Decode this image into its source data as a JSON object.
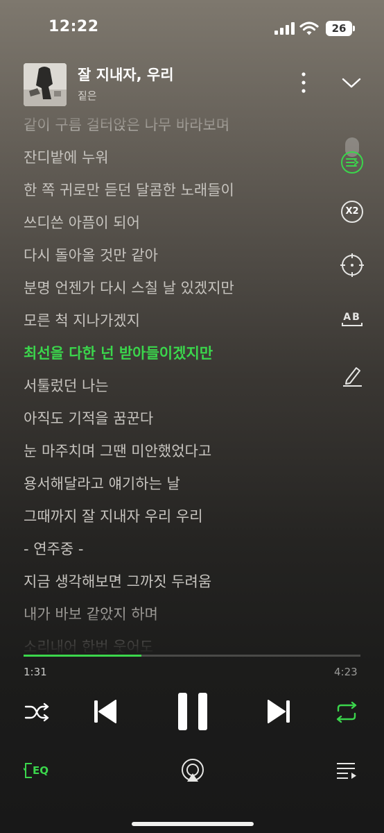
{
  "status_bar": {
    "time": "12:22",
    "battery": "26"
  },
  "track": {
    "title": "잘 지내자, 우리",
    "artist": "짙은"
  },
  "lyrics": [
    {
      "text": "같이 구름 걸터앉은 나무 바라보며",
      "active": false
    },
    {
      "text": "잔디밭에 누워",
      "active": false
    },
    {
      "text": "한 쪽 귀로만 듣던 달콤한 노래들이",
      "active": false
    },
    {
      "text": "쓰디쓴 아픔이 되어",
      "active": false
    },
    {
      "text": "다시 돌아올 것만 같아",
      "active": false
    },
    {
      "text": "분명 언젠가 다시 스칠 날 있겠지만",
      "active": false
    },
    {
      "text": "모른 척 지나가겠지",
      "active": false
    },
    {
      "text": "최선을 다한 넌 받아들이겠지만",
      "active": true
    },
    {
      "text": "서툴렀던 나는",
      "active": false
    },
    {
      "text": "아직도 기적을 꿈꾼다",
      "active": false
    },
    {
      "text": "눈 마주치며 그땐 미안했었다고",
      "active": false
    },
    {
      "text": "용서해달라고 얘기하는 날",
      "active": false
    },
    {
      "text": "그때까지 잘 지내자 우리 우리",
      "active": false
    },
    {
      "text": " - 연주중 -",
      "active": false
    },
    {
      "text": "지금 생각해보면 그까짓 두려움",
      "active": false
    },
    {
      "text": "내가 바보 같았지 하며",
      "active": false
    },
    {
      "text": "소리내어 한번 웃어도",
      "active": false
    }
  ],
  "side_tools": {
    "speed_label": "X2",
    "translate_label": "AB"
  },
  "playback": {
    "current_time": "1:31",
    "total_time": "4:23",
    "progress": 0.35
  },
  "bottom_bar": {
    "eq_label": "EQ"
  },
  "colors": {
    "accent": "#3bd64c",
    "lyric": "#c7c4bf",
    "background_dark": "#1c1c1b"
  }
}
